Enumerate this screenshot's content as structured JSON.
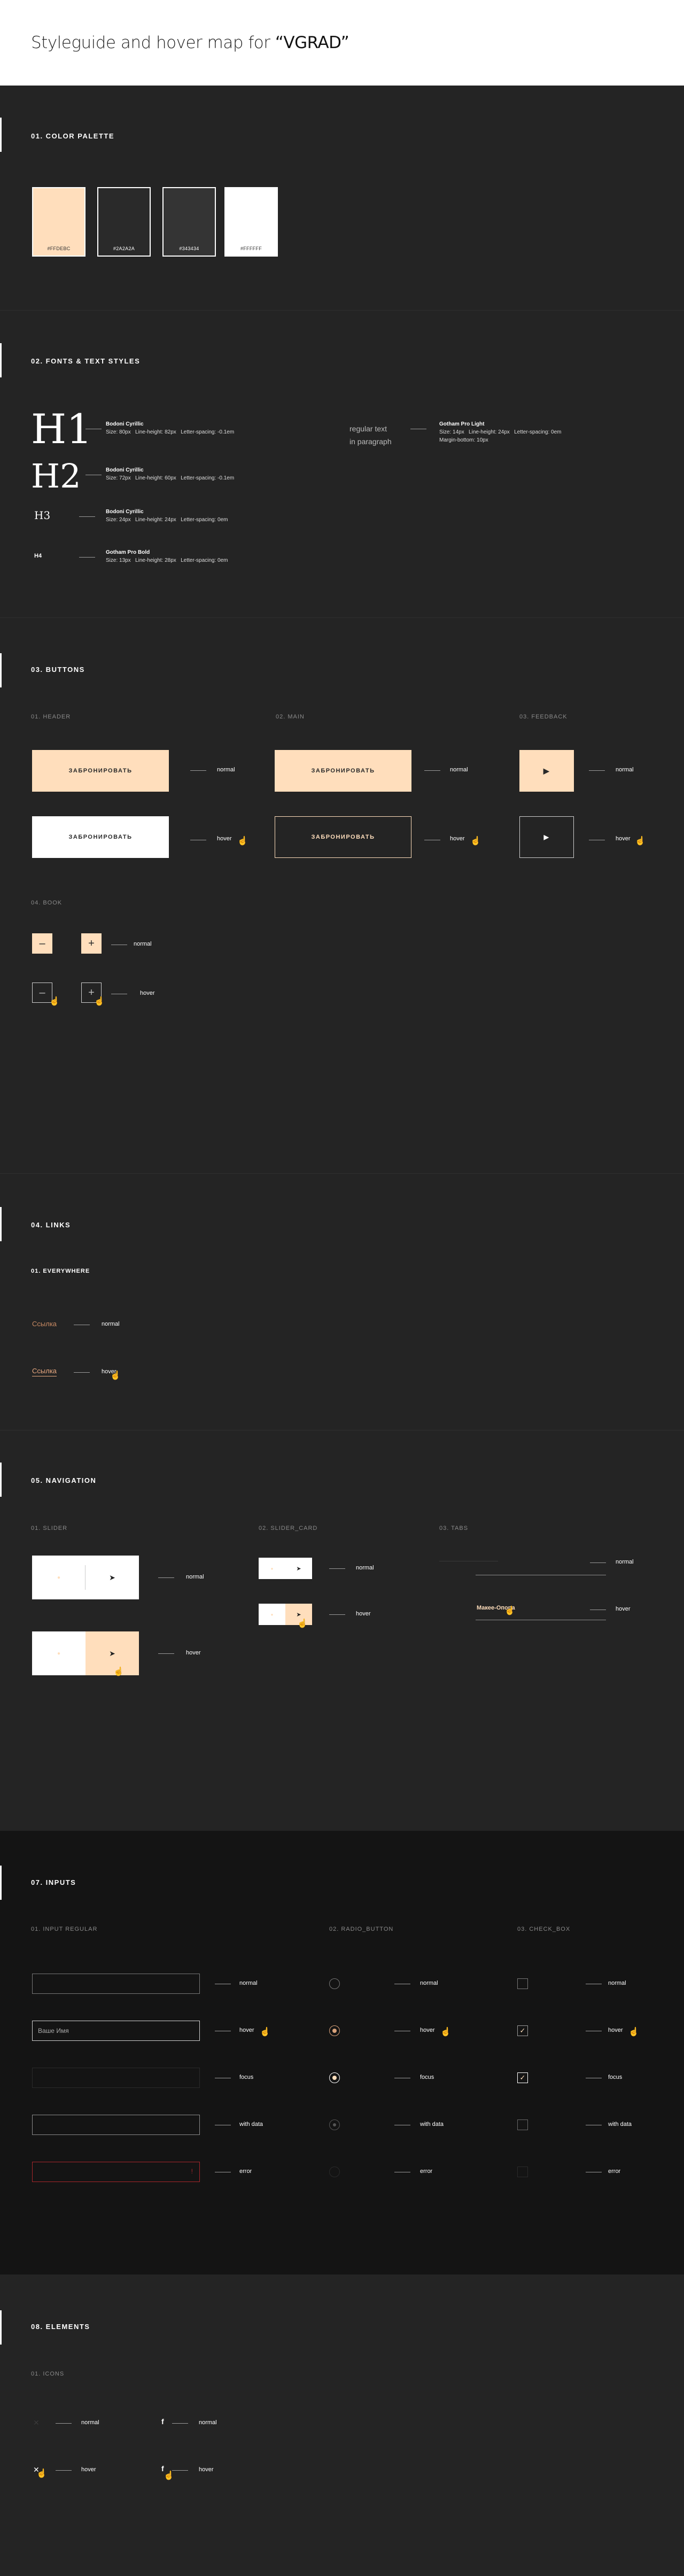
{
  "header": {
    "prefix": "Styleguide and hover map for ",
    "project": "“VGRAD”"
  },
  "palette": {
    "title": "01. COLOR PALETTE",
    "colors": [
      {
        "hex": "#FFDEBC",
        "label": "#FFDEBC"
      },
      {
        "hex": "#2A2A2A",
        "label": "#2A2A2A"
      },
      {
        "hex": "#343434",
        "label": "#343434"
      },
      {
        "hex": "#FFFFFF",
        "label": "#FFFFFF"
      }
    ]
  },
  "fonts": {
    "title": "02. FONTS & TEXT STYLES",
    "h1": {
      "sample": "H1",
      "font": "Bodoni Cyrillic",
      "size": "Size: 80px",
      "lh": "Line-height: 82px",
      "ls": "Letter-spacing: -0.1em"
    },
    "h2": {
      "sample": "H2",
      "font": "Bodoni Cyrillic",
      "size": "Size: 72px",
      "lh": "Line-height: 60px",
      "ls": "Letter-spacing: -0.1em"
    },
    "h3": {
      "sample": "H3",
      "font": "Bodoni Cyrillic",
      "size": "Size: 24px",
      "lh": "Line-height: 24px",
      "ls": "Letter-spacing: 0em"
    },
    "h4": {
      "sample": "H4",
      "font": "Gotham Pro Bold",
      "size": "Size: 13px",
      "lh": "Line-height: 28px",
      "ls": "Letter-spacing: 0em"
    },
    "p": {
      "sample1": "regular text",
      "sample2": "in paragraph",
      "font": "Gotham Pro Light",
      "size": "Size: 14px",
      "lh": "Line-height: 24px",
      "ls": "Letter-spacing: 0em",
      "mb": "Margin-bottom: 10px"
    }
  },
  "buttons": {
    "title": "03. BUTTONS",
    "header_label": "01. HEADER",
    "main_label": "02. MAIN",
    "feedback_label": "03. FEEDBACK",
    "book_label": "04. BOOK",
    "cta": "ЗАБРОНИРОВАТЬ",
    "normal": "normal",
    "hover": "hover",
    "minus": "–",
    "plus": "+",
    "play": "▶"
  },
  "links": {
    "title": "04. LINKS",
    "everywhere_label": "01. EVERYWHERE",
    "link_text": "Ссылка",
    "normal": "normal",
    "hover": "hover"
  },
  "navigation": {
    "title": "05. NAVIGATION",
    "slider_label": "01. SLIDER",
    "slider_card_label": "02. SLIDER_CARD",
    "tabs_label": "03. TABS",
    "tab_hover_text": "Макее-Опора",
    "normal": "normal",
    "hover": "hover",
    "arrow_left": "←",
    "arrow_right": "➤"
  },
  "inputs": {
    "title": "07. INPUTS",
    "regular_label": "01. INPUT REGULAR",
    "radio_label": "02. RADIO_BUTTON",
    "check_label": "03. CHECK_BOX",
    "hover_value": "Ваше Имя",
    "states": [
      "normal",
      "hover",
      "focus",
      "with data",
      "error"
    ],
    "error_mark": "!"
  },
  "elements": {
    "title": "08. ELEMENTS",
    "icons_label": "01. ICONS",
    "normal": "normal",
    "hover": "hover",
    "close_glyph": "✕",
    "fb_glyph": "f"
  }
}
